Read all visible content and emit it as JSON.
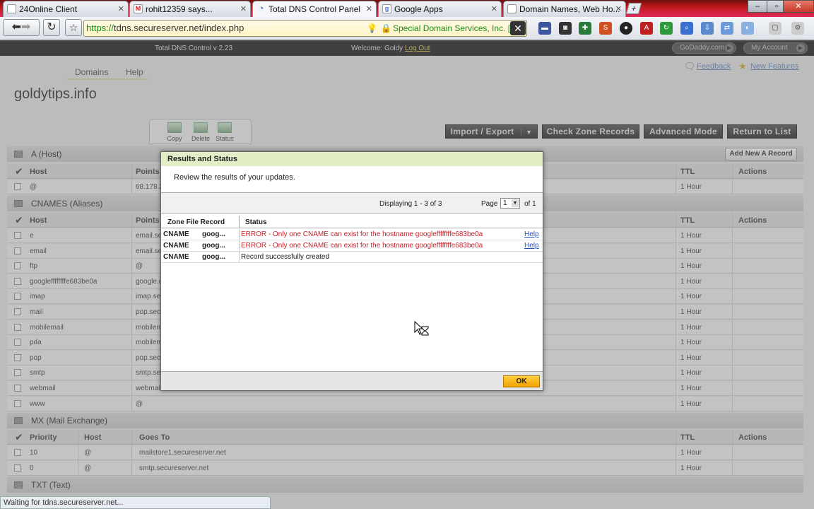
{
  "browser": {
    "tabs": [
      {
        "label": "24Online Client",
        "icon": "page-icon"
      },
      {
        "label": "rohit12359 says...",
        "icon": "gmail-icon"
      },
      {
        "label": "Total DNS Control Panel",
        "icon": "loading-icon",
        "active": true
      },
      {
        "label": "Google Apps",
        "icon": "google-icon"
      },
      {
        "label": "Domain Names, Web Ho...",
        "icon": "page-icon"
      }
    ],
    "url_scheme": "https://",
    "url_rest": "tdns.secureserver.net/index.php",
    "ev_cert": "Special Domain Services, Inc. [US]",
    "status": "Waiting for tdns.secureserver.net..."
  },
  "topbar": {
    "version": "Total DNS Control v 2.23",
    "welcome": "Welcome: Goldy",
    "logout": "Log Out",
    "godaddy_pill": "GoDaddy.com",
    "account_pill": "My Account"
  },
  "page": {
    "nav": {
      "domains": "Domains",
      "help": "Help"
    },
    "domain": "goldytips.info",
    "feedback": "Feedback",
    "new_features": "New Features",
    "tools": {
      "copy": "Copy",
      "delete": "Delete",
      "status": "Status"
    },
    "buttons": {
      "import_export": "Import / Export",
      "check_zone": "Check Zone Records",
      "advanced": "Advanced Mode",
      "return": "Return to List",
      "add_a": "Add New A Record"
    },
    "sections": {
      "a": "A (Host)",
      "cname": "CNAMES (Aliases)",
      "mx": "MX (Mail Exchange)",
      "txt": "TXT (Text)"
    },
    "cols": {
      "host": "Host",
      "points_to": "Points",
      "ttl": "TTL",
      "actions": "Actions",
      "priority": "Priority",
      "goes_to": "Goes To"
    },
    "a_rows": [
      {
        "host": "@",
        "points": "68.178.2",
        "ttl": "1 Hour"
      }
    ],
    "cname_rows": [
      {
        "host": "e",
        "points": "email.se",
        "ttl": "1 Hour"
      },
      {
        "host": "email",
        "points": "email.se",
        "ttl": "1 Hour"
      },
      {
        "host": "ftp",
        "points": "@",
        "ttl": "1 Hour"
      },
      {
        "host": "googleffffffffe683be0a",
        "points": "google.c",
        "ttl": "1 Hour"
      },
      {
        "host": "imap",
        "points": "imap.sec",
        "ttl": "1 Hour"
      },
      {
        "host": "mail",
        "points": "pop.sec",
        "ttl": "1 Hour"
      },
      {
        "host": "mobilemail",
        "points": "mobilem",
        "ttl": "1 Hour"
      },
      {
        "host": "pda",
        "points": "mobilem",
        "ttl": "1 Hour"
      },
      {
        "host": "pop",
        "points": "pop.sec",
        "ttl": "1 Hour"
      },
      {
        "host": "smtp",
        "points": "smtp.se",
        "ttl": "1 Hour"
      },
      {
        "host": "webmail",
        "points": "webmai",
        "ttl": "1 Hour"
      },
      {
        "host": "www",
        "points": "@",
        "ttl": "1 Hour"
      }
    ],
    "mx_rows": [
      {
        "priority": "10",
        "host": "@",
        "goes_to": "mailstore1.secureserver.net",
        "ttl": "1 Hour"
      },
      {
        "priority": "0",
        "host": "@",
        "goes_to": "smtp.secureserver.net",
        "ttl": "1 Hour"
      }
    ]
  },
  "modal": {
    "title": "Results and Status",
    "subtitle": "Review the results of your updates.",
    "displaying": "Displaying 1 - 3 of 3",
    "page_label": "Page",
    "page_value": "1",
    "of_label": "of 1",
    "col_record": "Zone File Record",
    "col_status": "Status",
    "rows": [
      {
        "type": "CNAME",
        "host": "goog...",
        "status": "ERROR - Only one CNAME can exist for the hostname googleffffffffe683be0a",
        "help": "Help",
        "error": true
      },
      {
        "type": "CNAME",
        "host": "goog...",
        "status": "ERROR - Only one CNAME can exist for the hostname googleffffffffe683be0a",
        "help": "Help",
        "error": true
      },
      {
        "type": "CNAME",
        "host": "goog...",
        "status": "Record successfully created",
        "help": "",
        "error": false
      }
    ],
    "ok": "OK"
  }
}
